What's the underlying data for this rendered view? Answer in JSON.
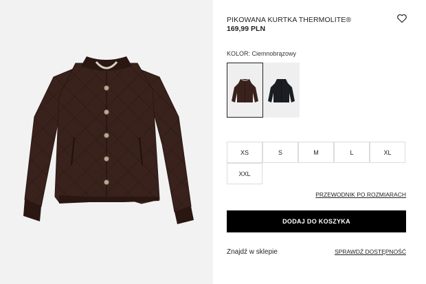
{
  "product": {
    "title": "PIKOWANA KURTKA THERMOLITE®",
    "price": "169,99 PLN"
  },
  "icons": {
    "favorite": "heart-outline-icon"
  },
  "color": {
    "label": "KOLOR: Ciemnobrązowy",
    "selected_index": 0,
    "swatches": [
      {
        "name": "Ciemnobrązowy",
        "hex": "#3a221c"
      },
      {
        "name": "Czarny",
        "hex": "#1a1d22"
      }
    ]
  },
  "sizes": [
    "XS",
    "S",
    "M",
    "L",
    "XL",
    "XXL"
  ],
  "links": {
    "size_guide": "PRZEWODNIK PO ROZMIARACH",
    "check_availability": "SPRAWDŹ DOSTĘPNOŚĆ"
  },
  "buttons": {
    "add_to_cart": "DODAJ DO KOSZYKA"
  },
  "store": {
    "label": "Znajdź w sklepie"
  },
  "colors": {
    "background_image": "#f2f2f2",
    "jacket_brown": "#3a221c",
    "button_black": "#000000"
  }
}
